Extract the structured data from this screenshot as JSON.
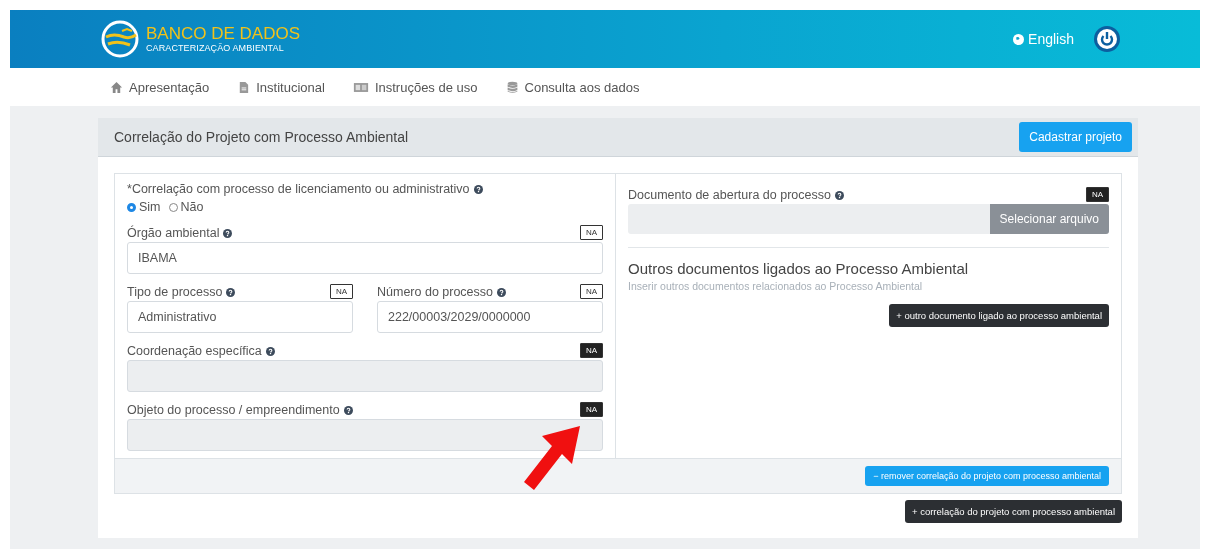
{
  "header": {
    "logo_title": "BANCO DE DADOS",
    "logo_subtitle": "CARACTERIZAÇÃO AMBIENTAL",
    "language": "English"
  },
  "nav": [
    {
      "label": "Apresentação",
      "kind": "home"
    },
    {
      "label": "Institucional",
      "kind": "document"
    },
    {
      "label": "Instruções de uso",
      "kind": "book"
    },
    {
      "label": "Consulta aos dados",
      "kind": "database"
    }
  ],
  "section": {
    "title": "Correlação do Projeto com Processo Ambiental",
    "register_button": "Cadastrar projeto"
  },
  "correlation": {
    "required_mark": "*",
    "label": "Correlação com processo de licenciamento ou administrativo",
    "options": [
      {
        "label": "Sim",
        "selected": true
      },
      {
        "label": "Não",
        "selected": false
      }
    ]
  },
  "field_rows": [
    [
      {
        "label": "Órgão ambiental",
        "value": "IBAMA",
        "na_label": "NA",
        "na_selected": false,
        "disabled": false
      }
    ],
    [
      {
        "label": "Tipo de processo",
        "value": "Administrativo",
        "na_label": "NA",
        "na_selected": false,
        "disabled": false
      },
      {
        "label": "Número do processo",
        "value": "222/00003/2029/0000000",
        "na_label": "NA",
        "na_selected": false,
        "disabled": false
      }
    ],
    [
      {
        "label": "Coordenação específica",
        "na_label": "NA",
        "na_selected": true,
        "disabled": true
      }
    ],
    [
      {
        "label": "Objeto do processo / empreendimento",
        "na_label": "NA",
        "na_selected": true,
        "disabled": true
      }
    ]
  ],
  "document": {
    "label": "Documento de abertura do processo",
    "na_label": "NA",
    "na_selected": true,
    "button": "Selecionar arquivo"
  },
  "others": {
    "title": "Outros documentos ligados ao Processo Ambiental",
    "hint": "Inserir outros documentos relacionados ao Processo Ambiental",
    "add_button": "+ outro documento ligado ao processo ambiental"
  },
  "remove_button": "− remover correlação do projeto com processo ambiental",
  "add_correlation_button": "+ correlação do projeto com processo ambiental"
}
